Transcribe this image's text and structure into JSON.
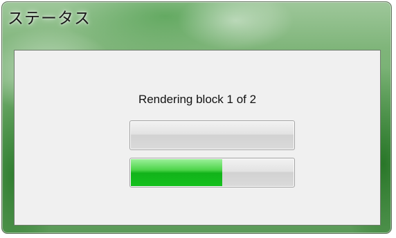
{
  "window": {
    "title": "ステータス"
  },
  "status": {
    "message": "Rendering block 1 of 2"
  },
  "progress_bars": [
    {
      "name": "block-progress",
      "value_percent": 0
    },
    {
      "name": "overall-progress",
      "value_percent": 56
    }
  ],
  "colors": {
    "progress_fill": "#14c01d",
    "progress_track": "#dadada",
    "client_background": "#f0f0f0"
  }
}
